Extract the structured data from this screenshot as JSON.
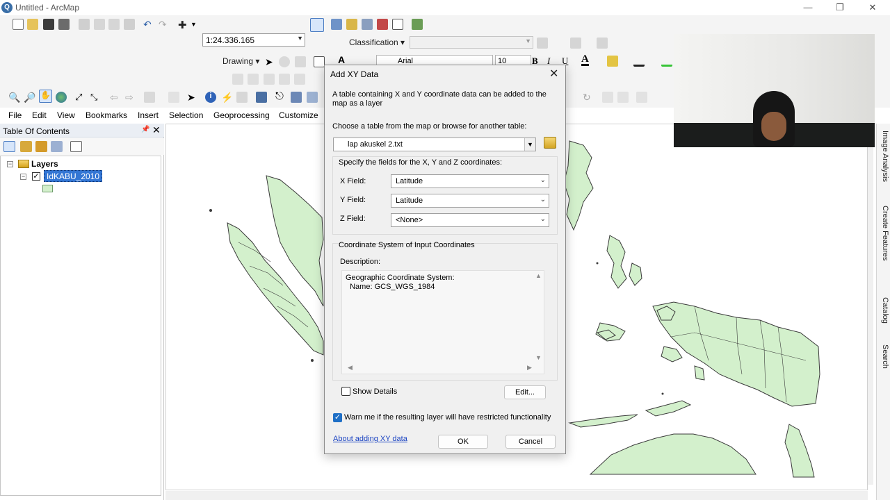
{
  "window": {
    "title": "Untitled - ArcMap",
    "app_icon": "arcmap-globe-icon",
    "controls": [
      "minimize-icon",
      "restore-icon",
      "close-icon"
    ]
  },
  "toolbar": {
    "scale": "1:24.336.165",
    "classification_label": "Classification ▾",
    "drawing_label": "Drawing ▾",
    "font": "Arial",
    "font_size": "10",
    "bold": "B",
    "italic": "I",
    "underline": "U",
    "text_color_glyph": "A"
  },
  "menu": {
    "items": [
      "File",
      "Edit",
      "View",
      "Bookmarks",
      "Insert",
      "Selection",
      "Geoprocessing",
      "Customize"
    ]
  },
  "toc": {
    "title": "Table Of Contents",
    "pin_glyph": "📌",
    "close_glyph": "✕",
    "root_label": "Layers",
    "layer_name": "IdKABU_2010",
    "layer_fill_color": "#d3f0cc",
    "layer_outline_color": "#3b3b3b"
  },
  "right_dock": {
    "tabs": [
      "Image Analysis",
      "Create Features",
      "Catalog",
      "Search"
    ]
  },
  "dialog": {
    "title": "Add XY Data",
    "intro": "A table containing X and Y coordinate data can be added to the map as a layer",
    "intro_line1": "A table containing X and Y coordinate data can be added to the",
    "intro_line2": "map as a layer",
    "choose_label": "Choose a table from the map or browse for another table:",
    "table_value": "lap akuskel 2.txt",
    "fields_heading": "Specify the fields for the X, Y and Z coordinates:",
    "x_label": "X Field:",
    "x_value": "Latitude",
    "y_label": "Y Field:",
    "y_value": "Latitude",
    "z_label": "Z Field:",
    "z_value": "<None>",
    "coord_heading": "Coordinate System of Input Coordinates",
    "description_label": "Description:",
    "description_line1": "Geographic Coordinate System:",
    "description_line2": "  Name: GCS_WGS_1984",
    "show_details_label": "Show Details",
    "show_details_checked": false,
    "edit_button": "Edit...",
    "warn_label": "Warn me if the resulting layer will have restricted functionality",
    "warn_checked": true,
    "help_link": "About adding XY data",
    "ok_button": "OK",
    "cancel_button": "Cancel",
    "close_glyph": "✕"
  },
  "colors": {
    "accent": "#3376d4",
    "map_land": "#d3f0cc",
    "map_border": "#3b3b3b",
    "checkbox_checked": "#1f6fc6"
  }
}
